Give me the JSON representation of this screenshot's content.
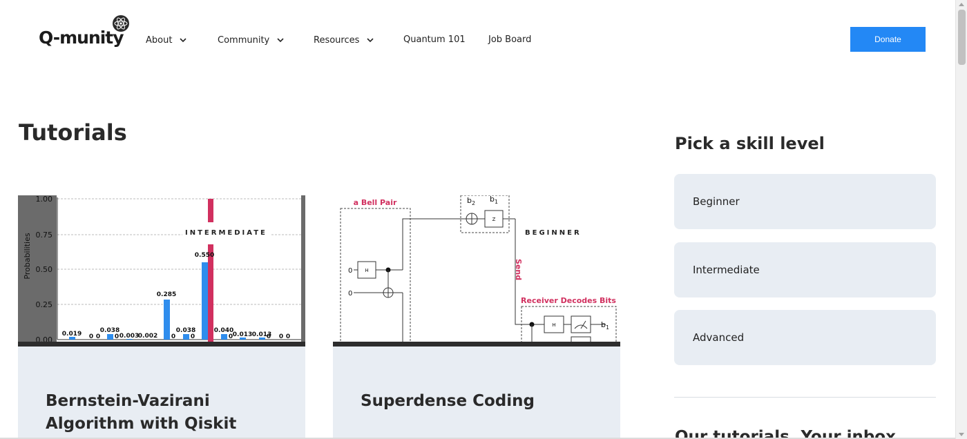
{
  "header": {
    "logo_text": "Q-munity",
    "nav": [
      {
        "label": "About",
        "has_dropdown": true
      },
      {
        "label": "Community",
        "has_dropdown": true
      },
      {
        "label": "Resources",
        "has_dropdown": true
      },
      {
        "label": "Quantum 101",
        "has_dropdown": false
      },
      {
        "label": "Job Board",
        "has_dropdown": false
      }
    ],
    "donate_label": "Donate"
  },
  "page": {
    "title": "Tutorials"
  },
  "tutorials": [
    {
      "level": "INTERMEDIATE",
      "title": "Bernstein-Vazirani Algorithm with Qiskit",
      "chart": {
        "ylabel": "Probabilities",
        "yticks": [
          "1.00",
          "0.75",
          "0.50",
          "0.25",
          "0.00"
        ],
        "value_labels": [
          "0.019",
          "0",
          "0",
          "0.038",
          "0",
          "0.003",
          "0.002",
          "0.285",
          "0",
          "0.038",
          "0",
          "0.550",
          "0.040",
          "0",
          "0.013",
          "0.013",
          "0",
          "0",
          "0"
        ]
      }
    },
    {
      "level": "BEGINNER",
      "title": "Superdense Coding",
      "diagram": {
        "bell_pair_label": "a Bell Pair",
        "send_label": "Send",
        "receiver_label": "Receiver Decodes Bits",
        "b2": "b",
        "b2_sub": "2",
        "b1": "b",
        "b1_sub": "1",
        "gate_h": "H",
        "gate_z": "Z",
        "input_0a": "0",
        "input_0b": "0"
      }
    }
  ],
  "sidebar": {
    "title": "Pick a skill level",
    "levels": [
      "Beginner",
      "Intermediate",
      "Advanced"
    ],
    "inbox_title": "Our tutorials. Your inbox."
  },
  "colors": {
    "accent": "#2388f5",
    "bar": "#2f8ded",
    "highlight": "#d1305f",
    "card_bg": "#e8edf3"
  }
}
